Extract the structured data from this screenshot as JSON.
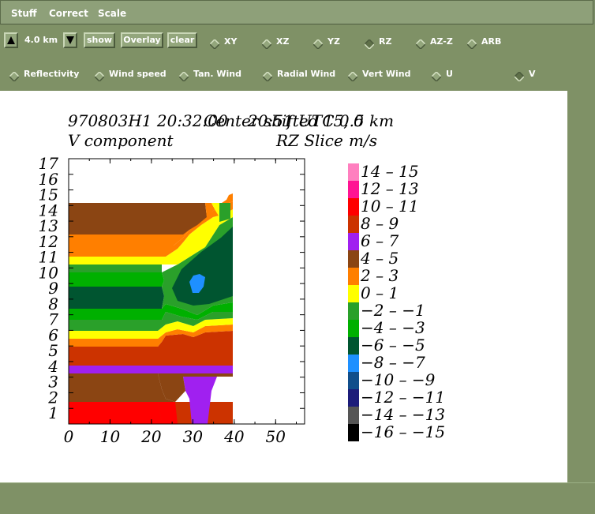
{
  "menubar": {
    "items": [
      "Stuff",
      "Correct",
      "Scale"
    ]
  },
  "toolbar": {
    "height_value": "4.0 km",
    "show_label": "show",
    "overlay_label": "Overlay",
    "clear_label": "clear",
    "views": [
      {
        "label": "XY",
        "selected": false
      },
      {
        "label": "XZ",
        "selected": false
      },
      {
        "label": "YZ",
        "selected": false
      },
      {
        "label": "RZ",
        "selected": true
      },
      {
        "label": "AZ-Z",
        "selected": false
      },
      {
        "label": "ARB",
        "selected": false
      }
    ],
    "fields": [
      {
        "label": "Reflectivity",
        "selected": false
      },
      {
        "label": "Wind speed",
        "selected": false
      },
      {
        "label": "Tan. Wind",
        "selected": false
      },
      {
        "label": "Radial Wind",
        "selected": false
      },
      {
        "label": "Vert Wind",
        "selected": false
      },
      {
        "label": "U",
        "selected": false
      },
      {
        "label": "V",
        "selected": true
      }
    ]
  },
  "plot": {
    "header_line1": "970803H1  20:32:00",
    "header_overlap": "Center shifted 15, 0",
    "header_right": "20:51 UTC  0.5 km",
    "component": "V component",
    "slice": "RZ Slice",
    "units": "m/s"
  },
  "chart_data": {
    "type": "heatmap",
    "xlim": [
      0,
      57
    ],
    "ylim": [
      0,
      17
    ],
    "x_ticks": [
      "0",
      "10",
      "20",
      "30",
      "40",
      "50"
    ],
    "y_ticks": [
      "1",
      "2",
      "3",
      "4",
      "5",
      "6",
      "7",
      "8",
      "9",
      "10",
      "11",
      "12",
      "13",
      "14",
      "15",
      "16",
      "17"
    ],
    "legend": [
      {
        "label": "14 – 15",
        "color": "#ff7fbf"
      },
      {
        "label": "12 – 13",
        "color": "#ff1493"
      },
      {
        "label": "10 – 11",
        "color": "#ff0000"
      },
      {
        "label": "8 – 9",
        "color": "#cc3300"
      },
      {
        "label": "6 – 7",
        "color": "#a020f0"
      },
      {
        "label": "4 – 5",
        "color": "#8b4513"
      },
      {
        "label": "2 – 3",
        "color": "#ff7f00"
      },
      {
        "label": "0 – 1",
        "color": "#ffff00"
      },
      {
        "label": "−2 – −1",
        "color": "#2aa02a"
      },
      {
        "label": "−4 – −3",
        "color": "#00b000"
      },
      {
        "label": "−6 – −5",
        "color": "#005530"
      },
      {
        "label": "−8 – −7",
        "color": "#1e90ff"
      },
      {
        "label": "−10 – −9",
        "color": "#104e8b"
      },
      {
        "label": "−12 – −11",
        "color": "#1c1c7a"
      },
      {
        "label": "−14 – −13",
        "color": "#555555"
      },
      {
        "label": "−16 – −15",
        "color": "#000000"
      }
    ]
  }
}
